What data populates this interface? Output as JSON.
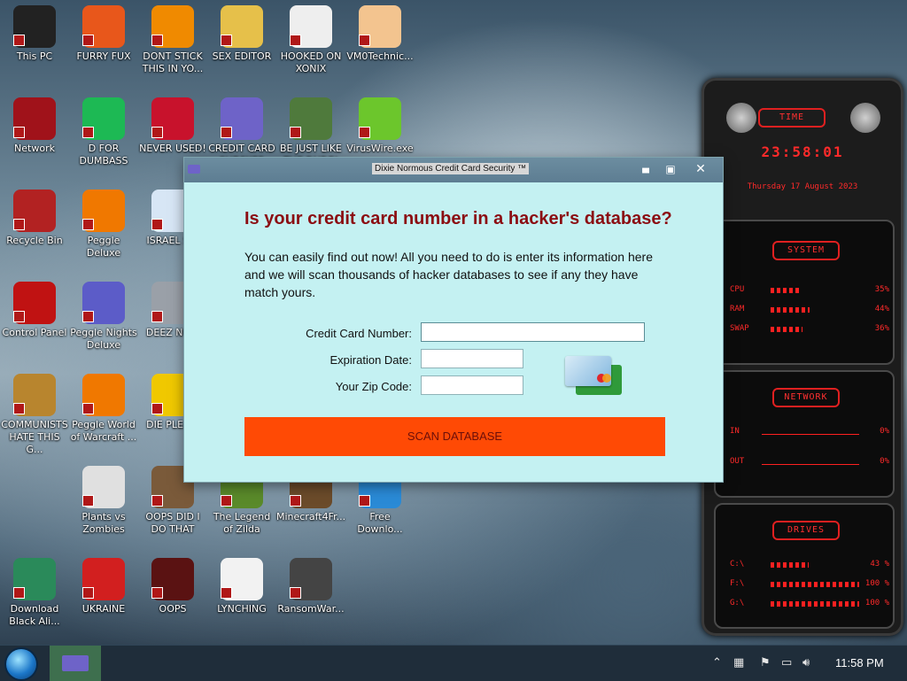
{
  "desktop_icons": [
    {
      "label": "This PC",
      "icon": "computer-icon",
      "color": "#222222"
    },
    {
      "label": "FURRY FUX",
      "icon": "firefox-icon",
      "color": "#e8571b"
    },
    {
      "label": "DONT STICK THIS IN YO...",
      "icon": "traffic-cone-icon",
      "color": "#f08a00"
    },
    {
      "label": "SEX EDITOR",
      "icon": "hxd-icon",
      "color": "#e6c04a"
    },
    {
      "label": "HOOKED ON XONIX",
      "icon": "xonix-icon",
      "color": "#eeeeee"
    },
    {
      "label": "VM0Technic...",
      "icon": "doctor-icon",
      "color": "#f3c48f"
    },
    {
      "label": "Network",
      "icon": "network-icon",
      "color": "#a0121a"
    },
    {
      "label": "D FOR DUMBASS",
      "icon": "spotify-icon",
      "color": "#1db954"
    },
    {
      "label": "NEVER USED!",
      "icon": "devcpp-icon",
      "color": "#c8122c"
    },
    {
      "label": "CREDIT CARD CHECKER",
      "icon": "credit-card-icon",
      "color": "#6e63c8"
    },
    {
      "label": "BE JUST LIKE THE DUDE!",
      "icon": "elf-icon",
      "color": "#4f7a3c"
    },
    {
      "label": "VirusWire.exe",
      "icon": "lime-icon",
      "color": "#6cc62c"
    },
    {
      "label": "Recycle Bin",
      "icon": "recycle-bin-icon",
      "color": "#b22222"
    },
    {
      "label": "Peggle Deluxe",
      "icon": "peggle-icon",
      "color": "#f07800"
    },
    {
      "label": "ISRAEL S...",
      "icon": "israel-icon",
      "color": "#d7e6f5"
    },
    {
      "label": "Control Panel",
      "icon": "control-panel-icon",
      "color": "#c01212"
    },
    {
      "label": "Peggle Nights Deluxe",
      "icon": "peggle-nights-icon",
      "color": "#5c5cc8"
    },
    {
      "label": "DEEZ NU...",
      "icon": "windows-stack-icon",
      "color": "#9aa0a8"
    },
    {
      "label": "COMMUNISTS HATE THIS G...",
      "icon": "money-bag-icon",
      "color": "#b8852e"
    },
    {
      "label": "Peggle World of Warcraft ...",
      "icon": "peggle-wow-icon",
      "color": "#f07800"
    },
    {
      "label": "DIE PLEA...",
      "icon": "die-icon",
      "color": "#f0c800"
    },
    {
      "label": "Plants vs Zombies",
      "icon": "plant-icon",
      "color": "#e0e0e0"
    },
    {
      "label": "OOPS DID I DO THAT",
      "icon": "portrait-icon",
      "color": "#7a5a3a"
    },
    {
      "label": "The Legend of Zilda",
      "icon": "zelda-icon",
      "color": "#5a8a2a"
    },
    {
      "label": "Minecraft4Fr...",
      "icon": "minecraft-icon",
      "color": "#6b4b2a"
    },
    {
      "label": "Free Downlo...",
      "icon": "share-arrow-icon",
      "color": "#2a8ad6"
    },
    {
      "label": "Download Black Ali...",
      "icon": "star-character-icon",
      "color": "#2a8a5a"
    },
    {
      "label": "UKRAINE",
      "icon": "radiation-icon",
      "color": "#d21f1f"
    },
    {
      "label": "OOPS",
      "icon": "app-red-icon",
      "color": "#5a1212"
    },
    {
      "label": "LYNCHING",
      "icon": "noose-icon",
      "color": "#f2f2f2"
    },
    {
      "label": "RansomWar...",
      "icon": "skull-icon",
      "color": "#444444"
    }
  ],
  "window": {
    "title": "Dixie Normous Credit Card Security ™",
    "minimize": "▄",
    "maximize": "▣",
    "close": "✕",
    "headline": "Is your credit card number in a hacker's database?",
    "intro": "You can easily find out now! All you need to do is enter its information here and we will scan thousands of hacker databases to see if any they have match yours.",
    "fields": {
      "card_label": "Credit Card Number:",
      "card_value": "",
      "exp_label": "Expiration Date:",
      "exp_value": "",
      "zip_label": "Your Zip Code:",
      "zip_value": ""
    },
    "scan_button": "SCAN DATABASE",
    "accent": "#ff4a05",
    "headline_color": "#8b0d12"
  },
  "sys_panel": {
    "time_title": "TIME",
    "time": "23:58:01",
    "date": "Thursday 17 August 2023",
    "system_title": "SYSTEM",
    "system_rows": [
      {
        "label": "CPU",
        "value": "35%",
        "fill": 0.35
      },
      {
        "label": "RAM",
        "value": "44%",
        "fill": 0.44
      },
      {
        "label": "SWAP",
        "value": "36%",
        "fill": 0.36
      }
    ],
    "network_title": "NETWORK",
    "network_rows": [
      {
        "label": "IN",
        "value": "0%"
      },
      {
        "label": "OUT",
        "value": "0%"
      }
    ],
    "drives_title": "DRIVES",
    "drive_rows": [
      {
        "label": "C:\\",
        "value": "43 %",
        "fill": 0.43
      },
      {
        "label": "F:\\",
        "value": "100 %",
        "fill": 1.0
      },
      {
        "label": "G:\\",
        "value": "100 %",
        "fill": 1.0
      }
    ]
  },
  "taskbar": {
    "clock": "11:58 PM",
    "tray_icons": [
      "chevron-up-icon",
      "network-tray-icon",
      "flag-icon",
      "action-center-icon",
      "volume-icon"
    ]
  }
}
